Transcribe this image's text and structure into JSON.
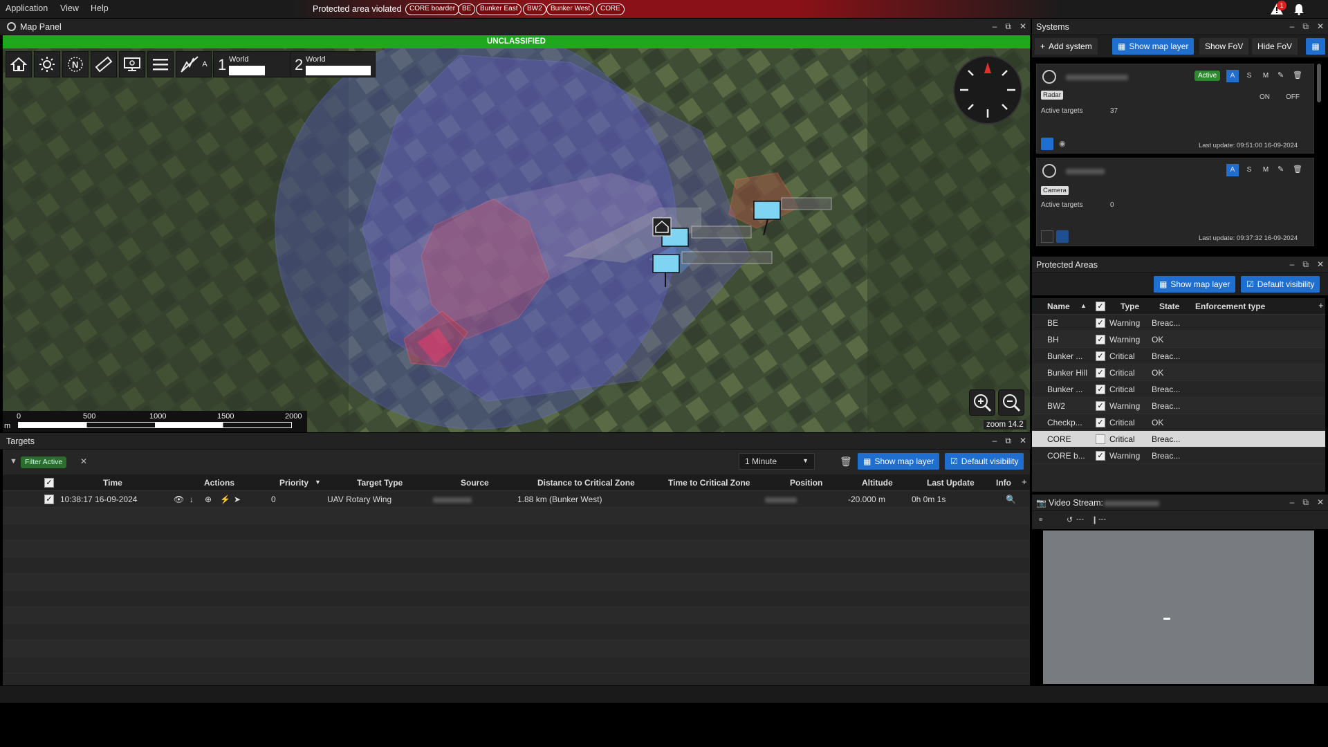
{
  "menubar": {
    "items": [
      "Application",
      "View",
      "Help"
    ],
    "alert_text": "Protected area violated",
    "alert_chips": [
      "CORE boarder",
      "BE",
      "Bunker East",
      "BW2",
      "Bunker West",
      "CORE"
    ],
    "notification_count": "1"
  },
  "map_panel": {
    "title": "Map Panel",
    "classification": "UNCLASSIFIED",
    "toolbar": {
      "world1_num": "1",
      "world1_label": "World",
      "world2_num": "2",
      "world2_label": "World",
      "auto_label": "A"
    },
    "scale": {
      "unit": "m",
      "ticks": [
        "0",
        "500",
        "1000",
        "1500",
        "2000"
      ]
    },
    "zoom_label": "zoom 14.2"
  },
  "targets": {
    "title": "Targets",
    "filter_chip": "Filter Active",
    "time_select": "1 Minute",
    "show_map_layer": "Show map layer",
    "default_visibility": "Default visibility",
    "columns": [
      "Time",
      "Actions",
      "Priority",
      "Target Type",
      "Source",
      "Distance to Critical Zone",
      "Time to Critical Zone",
      "Position",
      "Altitude",
      "Last Update",
      "Info"
    ],
    "rows": [
      {
        "time": "10:38:17 16-09-2024",
        "priority": "0",
        "target_type": "UAV Rotary Wing",
        "distance": "1.88 km (Bunker West)",
        "altitude": "-20.000 m",
        "last_update": "0h 0m 1s"
      }
    ]
  },
  "systems": {
    "title": "Systems",
    "add_system": "Add system",
    "show_map_layer": "Show map layer",
    "show_fov": "Show FoV",
    "hide_fov": "Hide FoV",
    "cards": [
      {
        "type_tag": "Radar",
        "status": "Active",
        "active_targets_label": "Active targets",
        "active_targets": "37",
        "on": "ON",
        "off": "OFF",
        "last_update": "Last update: 09:51:00 16-09-2024",
        "btn_a": "A",
        "btn_s": "S",
        "btn_m": "M"
      },
      {
        "type_tag": "Camera",
        "active_targets_label": "Active targets",
        "active_targets": "0",
        "last_update": "Last update: 09:37:32 16-09-2024",
        "btn_a": "A",
        "btn_s": "S",
        "btn_m": "M"
      }
    ]
  },
  "protected_areas": {
    "title": "Protected Areas",
    "show_map_layer": "Show map layer",
    "default_visibility": "Default visibility",
    "columns": [
      "Name",
      "Type",
      "State",
      "Enforcement type"
    ],
    "rows": [
      {
        "name": "BE",
        "type": "Warning",
        "state": "Breac..."
      },
      {
        "name": "BH",
        "type": "Warning",
        "state": "OK"
      },
      {
        "name": "Bunker ...",
        "type": "Critical",
        "state": "Breac..."
      },
      {
        "name": "Bunker Hill",
        "type": "Critical",
        "state": "OK"
      },
      {
        "name": "Bunker ...",
        "type": "Critical",
        "state": "Breac..."
      },
      {
        "name": "BW2",
        "type": "Warning",
        "state": "Breac..."
      },
      {
        "name": "Checkp...",
        "type": "Critical",
        "state": "OK"
      },
      {
        "name": "CORE",
        "type": "Critical",
        "state": "Breac..."
      },
      {
        "name": "CORE b...",
        "type": "Warning",
        "state": "Breac..."
      }
    ]
  },
  "video_stream": {
    "title": "Video Stream:",
    "control_a": "---",
    "control_b": "---"
  }
}
